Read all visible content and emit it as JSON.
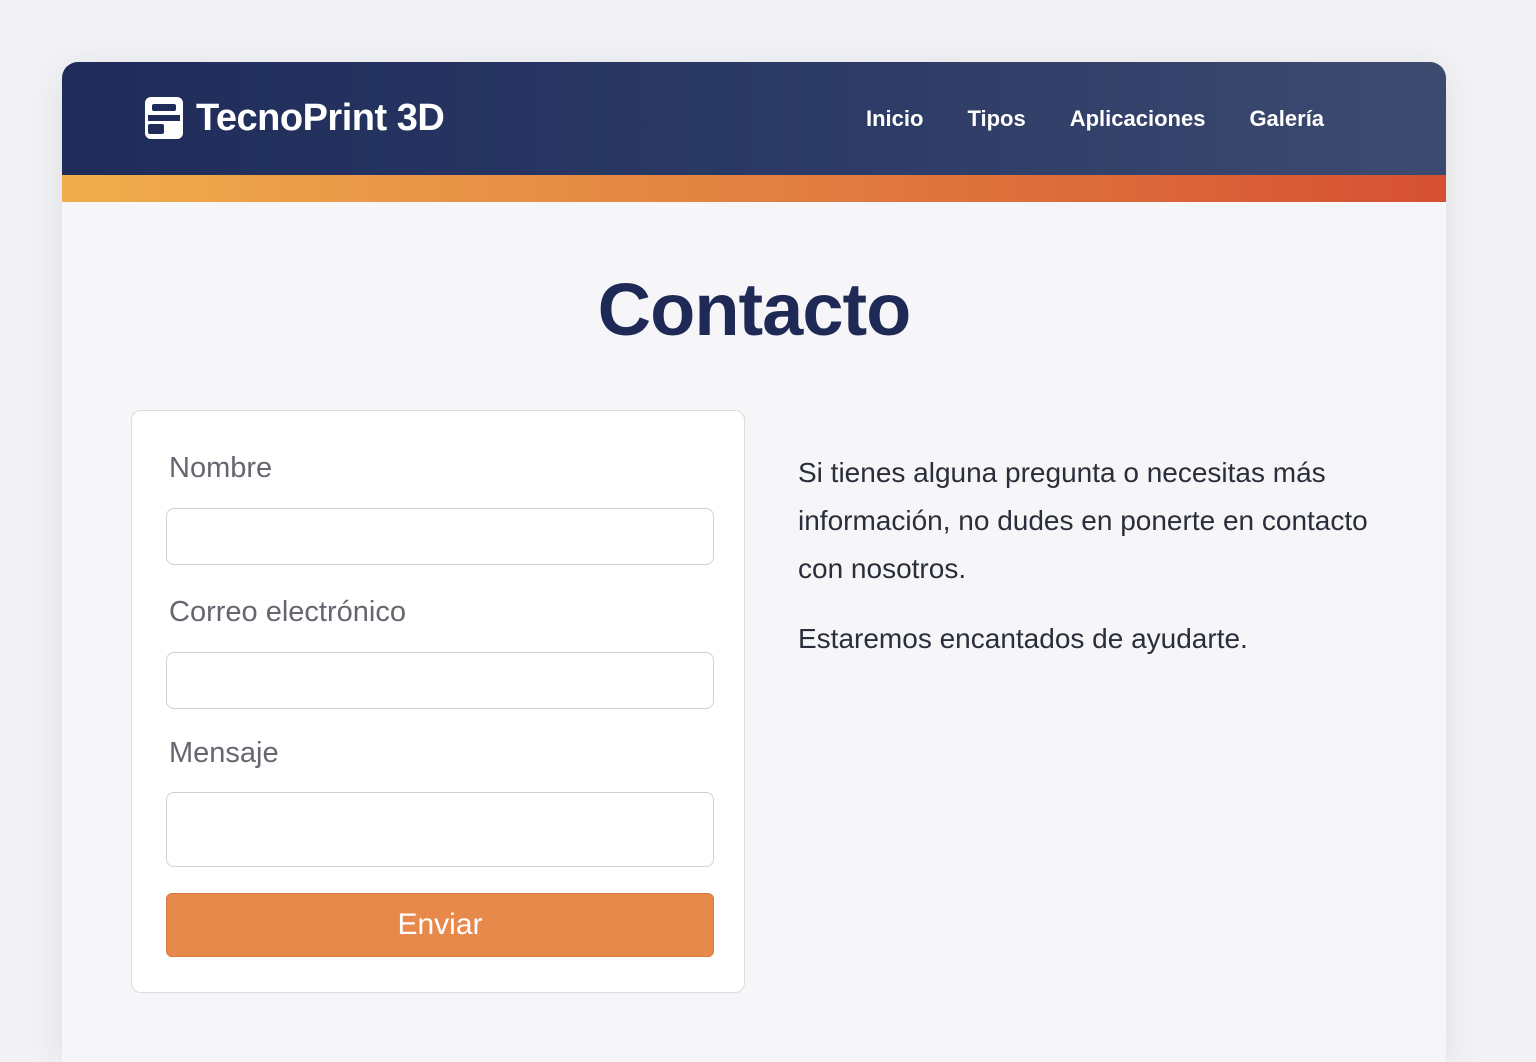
{
  "brand": {
    "name": "TecnoPrint 3D",
    "icon": "printer-logo-icon",
    "colors": {
      "header_dark": "#1f2c5a",
      "accent_orange": "#e8894c",
      "title_navy": "#1e2a55"
    }
  },
  "nav": {
    "items": [
      {
        "label": "Inicio"
      },
      {
        "label": "Tipos"
      },
      {
        "label": "Aplicaciones"
      },
      {
        "label": "Galería"
      }
    ]
  },
  "page": {
    "title": "Contacto"
  },
  "form": {
    "name_label": "Nombre",
    "name_value": "",
    "email_label": "Correo electrónico",
    "email_value": "",
    "message_label": "Mensaje",
    "message_value": "",
    "submit_label": "Enviar"
  },
  "info": {
    "paragraph1": "Si tienes alguna pregunta o necesitas más información, no dudes en ponerte en contacto con nosotros.",
    "paragraph2": "Estaremos encantados de ayudarte."
  }
}
